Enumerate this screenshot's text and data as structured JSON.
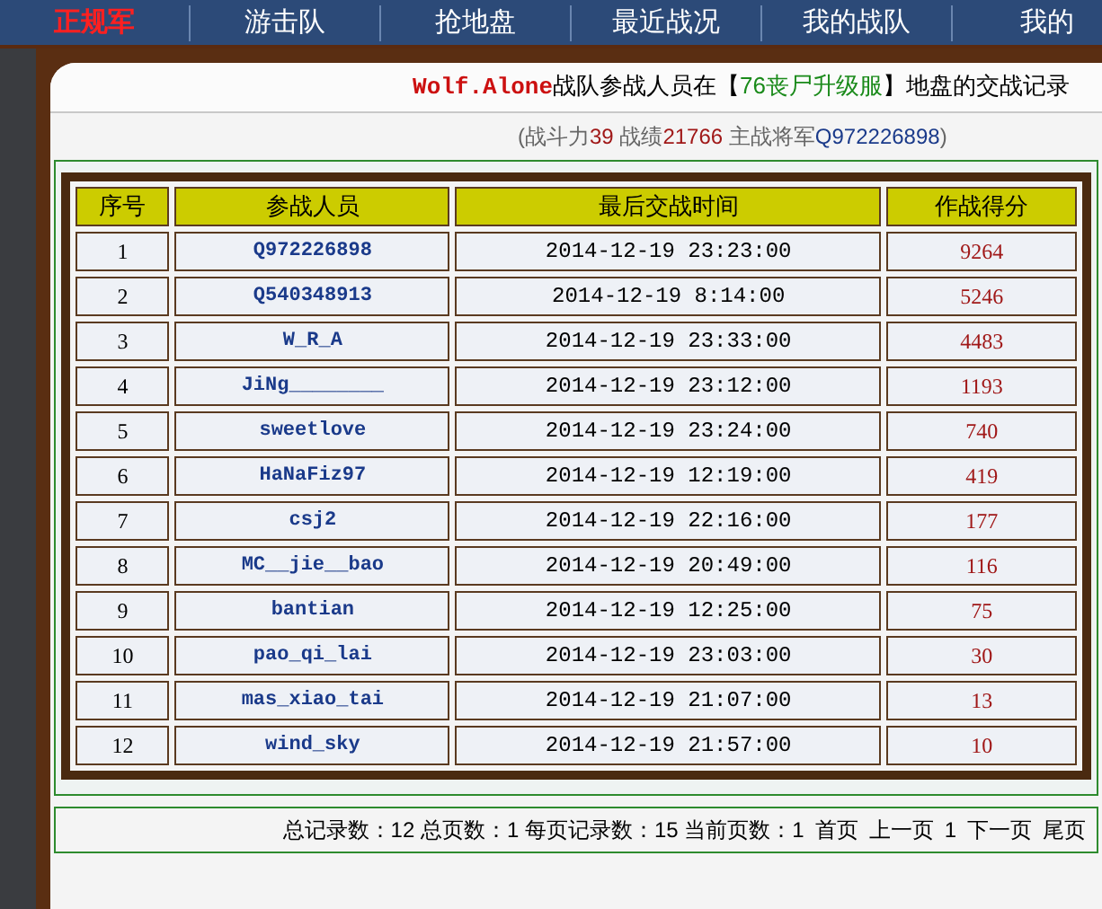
{
  "nav": [
    {
      "label": "正规军",
      "selected": true
    },
    {
      "label": "游击队",
      "selected": false
    },
    {
      "label": "抢地盘",
      "selected": false
    },
    {
      "label": "最近战况",
      "selected": false
    },
    {
      "label": "我的战队",
      "selected": false
    },
    {
      "label": "我的",
      "selected": false
    }
  ],
  "heading": {
    "team": "Wolf.Alone",
    "text_1": "战队参战人员在【",
    "territory": "76丧尸升级服",
    "text_2": "】地盘的交战记录"
  },
  "stats": {
    "open": "(战斗力",
    "power": "39",
    "record_label": " 战绩",
    "record": "21766",
    "general_label": " 主战将军",
    "general": "Q972226898",
    "close": ")"
  },
  "table": {
    "columns": [
      "序号",
      "参战人员",
      "最后交战时间",
      "作战得分"
    ],
    "rows": [
      [
        "1",
        "Q972226898",
        "2014-12-19 23:23:00",
        "9264"
      ],
      [
        "2",
        "Q540348913",
        "2014-12-19 8:14:00",
        "5246"
      ],
      [
        "3",
        "W_R_A",
        "2014-12-19 23:33:00",
        "4483"
      ],
      [
        "4",
        "JiNg________",
        "2014-12-19 23:12:00",
        "1193"
      ],
      [
        "5",
        "sweetlove",
        "2014-12-19 23:24:00",
        "740"
      ],
      [
        "6",
        "HaNaFiz97",
        "2014-12-19 12:19:00",
        "419"
      ],
      [
        "7",
        "csj2",
        "2014-12-19 22:16:00",
        "177"
      ],
      [
        "8",
        "MC__jie__bao",
        "2014-12-19 20:49:00",
        "116"
      ],
      [
        "9",
        "bantian",
        "2014-12-19 12:25:00",
        "75"
      ],
      [
        "10",
        "pao_qi_lai",
        "2014-12-19 23:03:00",
        "30"
      ],
      [
        "11",
        "mas_xiao_tai",
        "2014-12-19 21:07:00",
        "13"
      ],
      [
        "12",
        "wind_sky",
        "2014-12-19 21:57:00",
        "10"
      ]
    ]
  },
  "pagination": {
    "summary": "总记录数：12 总页数：1 每页记录数：15 当前页数：1",
    "links": [
      "首页",
      "上一页",
      "1",
      "下一页",
      "尾页"
    ]
  }
}
